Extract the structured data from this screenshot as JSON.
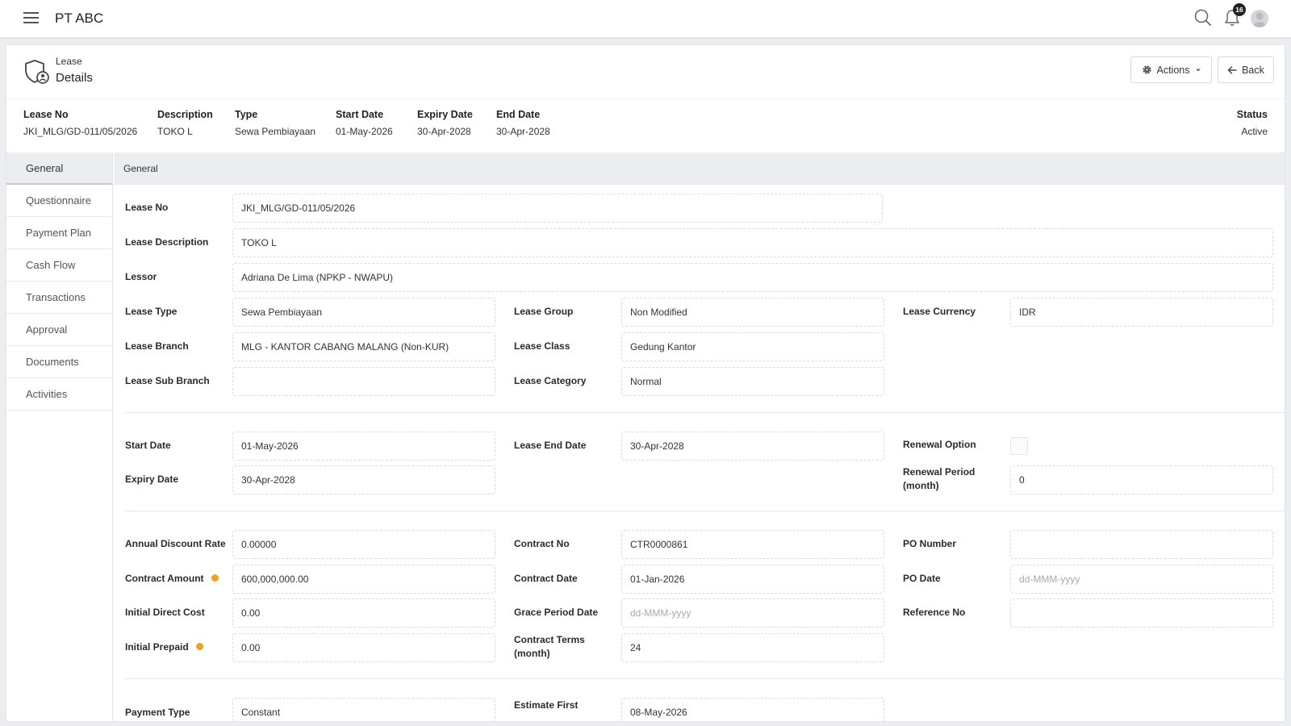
{
  "app": {
    "title": "PT ABC",
    "notification_count": "16"
  },
  "header": {
    "subtitle": "Lease",
    "title": "Details",
    "actions_label": "Actions",
    "back_label": "Back"
  },
  "summary": {
    "lease_no_label": "Lease No",
    "lease_no": "JKI_MLG/GD-011/05/2026",
    "description_label": "Description",
    "description": "TOKO L",
    "type_label": "Type",
    "type": "Sewa Pembiayaan",
    "start_date_label": "Start Date",
    "start_date": "01-May-2026",
    "expiry_date_label": "Expiry Date",
    "expiry_date": "30-Apr-2028",
    "end_date_label": "End Date",
    "end_date": "30-Apr-2028",
    "status_label": "Status",
    "status": "Active"
  },
  "sidenav": [
    "General",
    "Questionnaire",
    "Payment Plan",
    "Cash Flow",
    "Transactions",
    "Approval",
    "Documents",
    "Activities"
  ],
  "section_title": "General",
  "form": {
    "lease_no": {
      "label": "Lease No",
      "value": "JKI_MLG/GD-011/05/2026"
    },
    "lease_description": {
      "label": "Lease Description",
      "value": "TOKO L"
    },
    "lessor": {
      "label": "Lessor",
      "value": "Adriana De Lima (NPKP - NWAPU)"
    },
    "lease_type": {
      "label": "Lease Type",
      "value": "Sewa Pembiayaan"
    },
    "lease_group": {
      "label": "Lease Group",
      "value": "Non Modified"
    },
    "lease_currency": {
      "label": "Lease Currency",
      "value": "IDR"
    },
    "lease_branch": {
      "label": "Lease Branch",
      "value": "MLG - KANTOR CABANG MALANG (Non-KUR)"
    },
    "lease_class": {
      "label": "Lease Class",
      "value": "Gedung Kantor"
    },
    "lease_sub_branch": {
      "label": "Lease Sub Branch",
      "value": ""
    },
    "lease_category": {
      "label": "Lease Category",
      "value": "Normal"
    },
    "start_date": {
      "label": "Start Date",
      "value": "01-May-2026"
    },
    "lease_end_date": {
      "label": "Lease End Date",
      "value": "30-Apr-2028"
    },
    "renewal_option": {
      "label": "Renewal Option"
    },
    "expiry_date": {
      "label": "Expiry Date",
      "value": "30-Apr-2028"
    },
    "renewal_period": {
      "label_1": "Renewal Period",
      "label_2": "(month)",
      "value": "0"
    },
    "annual_discount_rate": {
      "label": "Annual Discount Rate",
      "value": "0.00000"
    },
    "contract_no": {
      "label": "Contract No",
      "value": "CTR0000861"
    },
    "po_number": {
      "label": "PO Number",
      "value": ""
    },
    "contract_amount": {
      "label": "Contract Amount",
      "value": "600,000,000.00"
    },
    "contract_date": {
      "label": "Contract Date",
      "value": "01-Jan-2026"
    },
    "po_date": {
      "label": "PO Date",
      "placeholder": "dd-MMM-yyyy"
    },
    "initial_direct_cost": {
      "label": "Initial Direct Cost",
      "value": "0.00"
    },
    "grace_period_date": {
      "label": "Grace Period Date",
      "placeholder": "dd-MMM-yyyy"
    },
    "reference_no": {
      "label": "Reference No",
      "value": ""
    },
    "initial_prepaid": {
      "label": "Initial Prepaid",
      "value": "0.00"
    },
    "contract_terms": {
      "label_1": "Contract Terms",
      "label_2": "(month)",
      "value": "24"
    },
    "payment_type": {
      "label": "Payment Type",
      "value": "Constant"
    },
    "estimate_first": {
      "label": "Estimate First",
      "value": "08-May-2026"
    }
  },
  "colors": {
    "accent_info": "#f0a020",
    "nav_active_bg": "#ebedf0"
  }
}
